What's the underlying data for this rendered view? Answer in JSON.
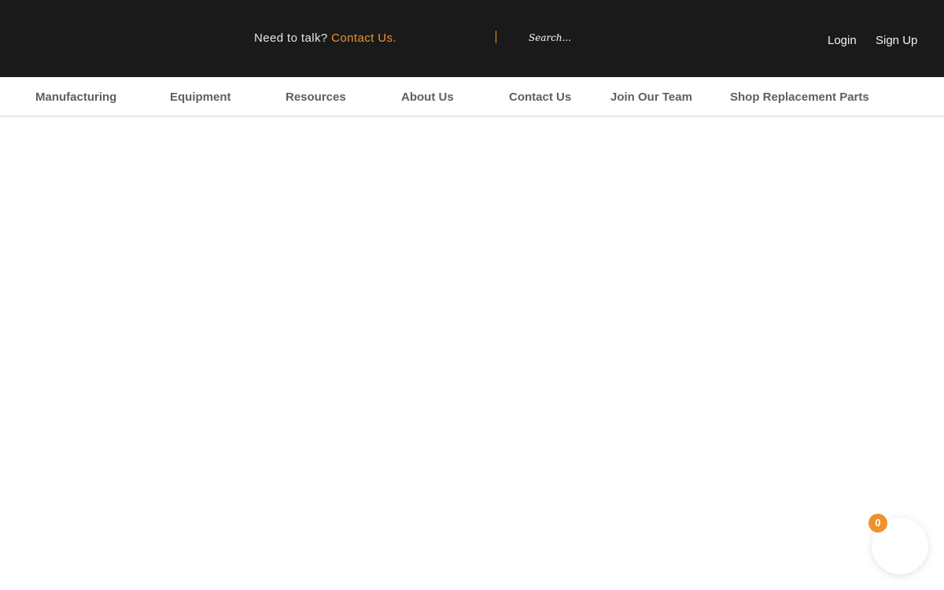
{
  "header": {
    "talk_prefix": "Need to talk?",
    "contact_link": "Contact Us.",
    "search_placeholder": "Search...",
    "login": "Login",
    "signup": "Sign Up"
  },
  "nav": {
    "items": [
      {
        "label": "Manufacturing"
      },
      {
        "label": "Equipment"
      },
      {
        "label": "Resources"
      },
      {
        "label": "About Us"
      },
      {
        "label": "Contact Us"
      },
      {
        "label": "Join Our Team"
      },
      {
        "label": "Shop Replacement Parts"
      }
    ]
  },
  "cart": {
    "count": "0"
  },
  "colors": {
    "topbar_bg": "#1a1a1a",
    "accent": "#f0922b",
    "nav_text": "#5e5e67"
  }
}
